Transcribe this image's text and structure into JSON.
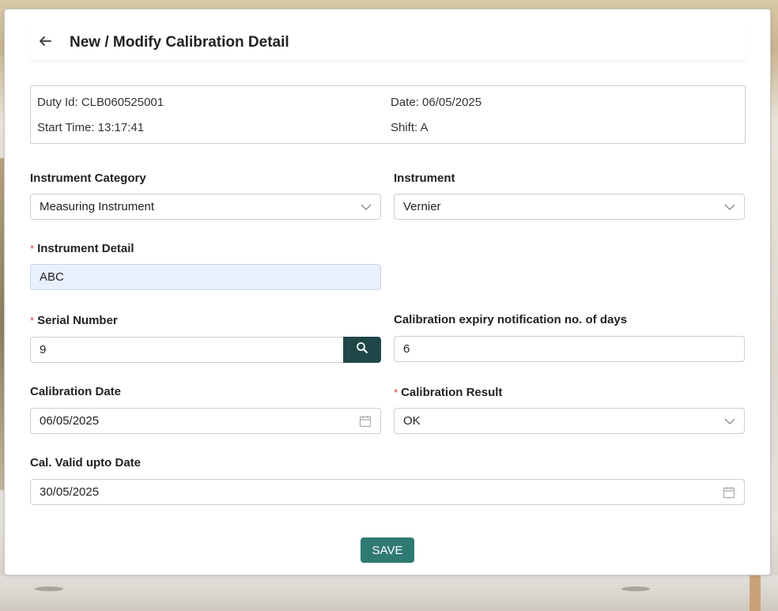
{
  "header": {
    "title": "New / Modify Calibration Detail"
  },
  "info": {
    "duty_id": "Duty Id: CLB060525001",
    "date": "Date: 06/05/2025",
    "start_time": "Start Time: 13:17:41",
    "shift": "Shift: A"
  },
  "form": {
    "instrument_category": {
      "label": "Instrument Category",
      "value": "Measuring Instrument"
    },
    "instrument": {
      "label": "Instrument",
      "value": "Vernier"
    },
    "instrument_detail": {
      "label": "Instrument Detail",
      "value": "ABC",
      "required": true
    },
    "serial_number": {
      "label": "Serial Number",
      "value": "9",
      "required": true
    },
    "expiry_days": {
      "label": "Calibration expiry notification no. of days",
      "value": "6"
    },
    "calibration_date": {
      "label": "Calibration Date",
      "value": "06/05/2025"
    },
    "calibration_result": {
      "label": "Calibration Result",
      "value": "OK",
      "required": true
    },
    "valid_upto": {
      "label": "Cal. Valid upto Date",
      "value": "30/05/2025"
    },
    "required_mark": "*"
  },
  "actions": {
    "save_label": "SAVE"
  },
  "colors": {
    "accent": "#2f7a73",
    "search_button": "#1f4747",
    "required": "#e03a3a",
    "filled_input": "#e8effd"
  },
  "icons": [
    "arrow-left-icon",
    "chevron-down-icon",
    "search-icon",
    "calendar-icon"
  ]
}
